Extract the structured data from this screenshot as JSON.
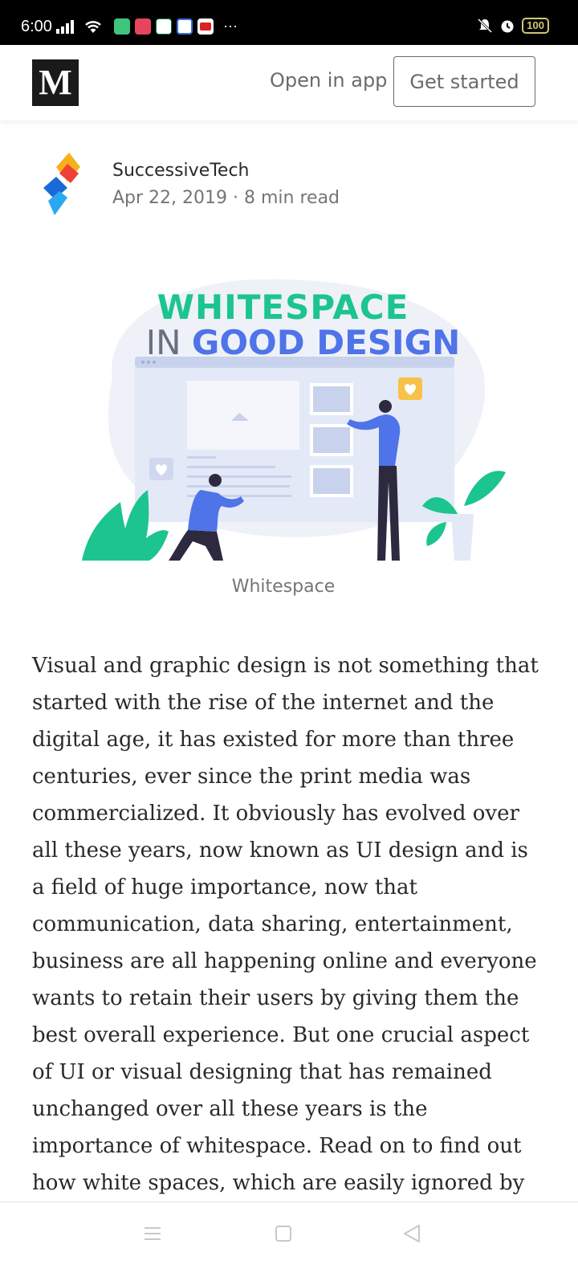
{
  "status_bar": {
    "time": "6:00",
    "battery": "100",
    "overflow": "···"
  },
  "header": {
    "logo": "M",
    "open_in_app": "Open in app",
    "get_started": "Get started"
  },
  "author": {
    "name": "SuccessiveTech",
    "meta": "Apr 22, 2019 · 8 min read"
  },
  "hero": {
    "title_line1": "WHITESPACE",
    "title_in": "IN ",
    "title_good": "GOOD DESIGN",
    "caption": "Whitespace"
  },
  "article": {
    "paragraph": "Visual and graphic design is not something that started with the rise of the internet and the digital age, it has existed for more than three centuries, ever since the print media was commercialized. It obviously has evolved over all these years, now known as UI design and is a field of huge importance, now that communication, data sharing, entertainment, business are all happening online and everyone wants to retain their users by giving them the best overall experience. But one crucial aspect of UI or visual designing that has remained unchanged over all these years is the importance of whitespace. Read on to find out how white spaces, which are easily ignored by users and"
  },
  "colors": {
    "accent_green": "#1cc48f",
    "accent_blue": "#4f73e8",
    "text_dark": "#292929",
    "text_muted": "#757575"
  },
  "icons": {
    "nav_menu": "menu-icon",
    "nav_home": "home-square-icon",
    "nav_back": "back-triangle-icon"
  }
}
